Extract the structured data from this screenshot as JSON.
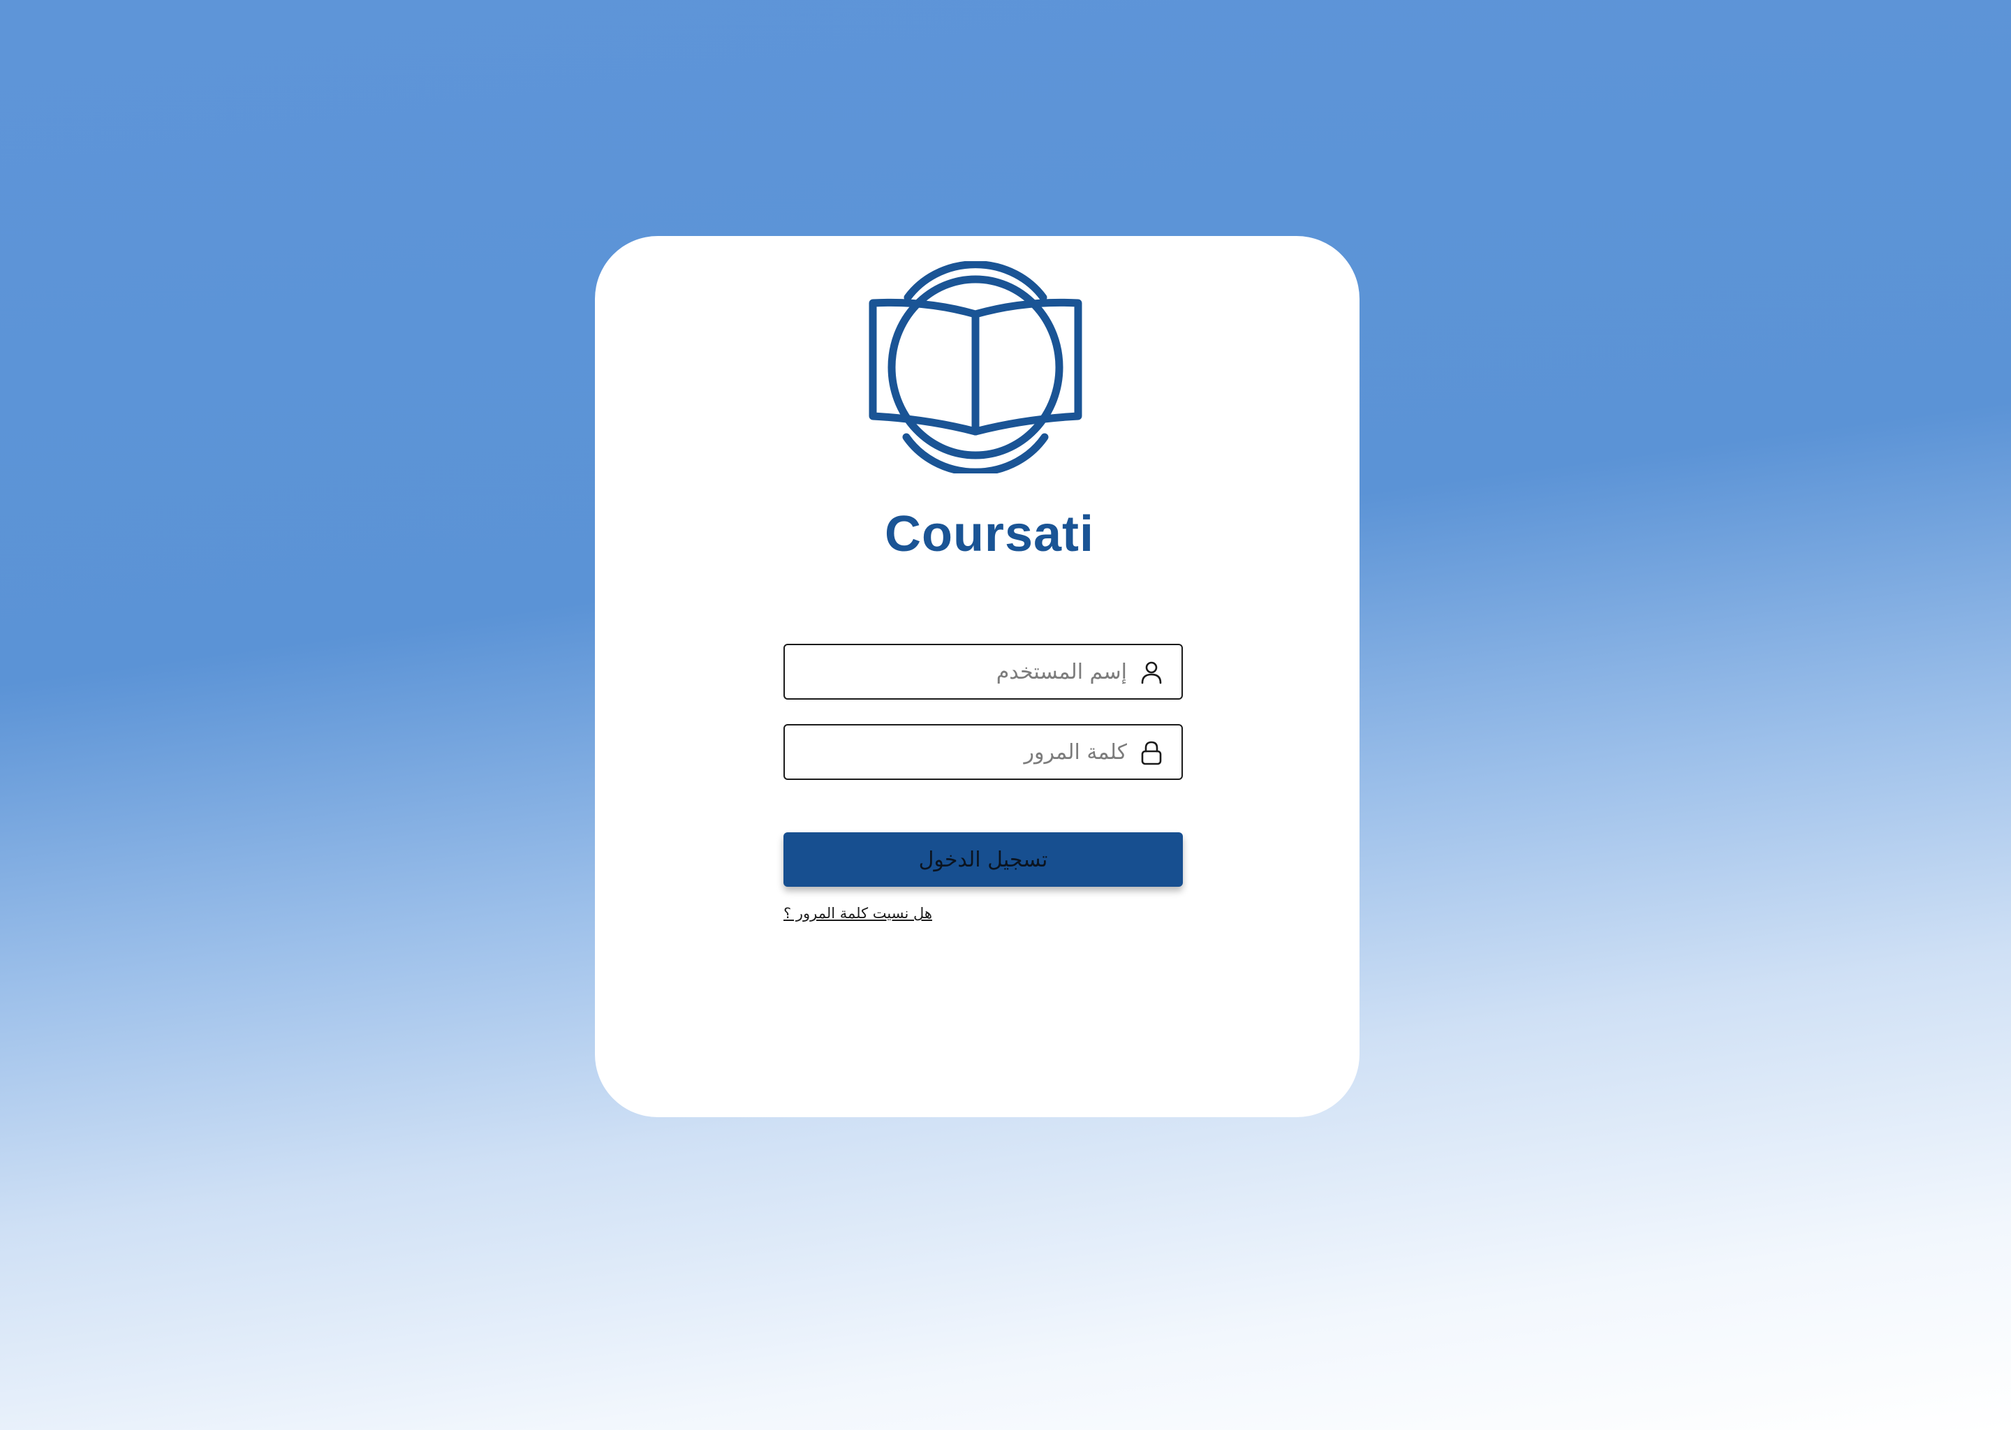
{
  "brand": {
    "name": "Coursati",
    "logo_icon": "open-book-globe-icon",
    "color": "#1a5495"
  },
  "login_form": {
    "username": {
      "placeholder": "إسم المستخدم",
      "value": "",
      "icon": "user-icon"
    },
    "password": {
      "placeholder": "كلمة المرور",
      "value": "",
      "icon": "lock-icon"
    },
    "submit_label": "تسجيل الدخول",
    "forgot_password_label": "هل نسيت كلمة المرور ؟"
  },
  "colors": {
    "button": "#174f90",
    "background_top": "#5e95d8",
    "background_bottom": "#ffffff"
  }
}
